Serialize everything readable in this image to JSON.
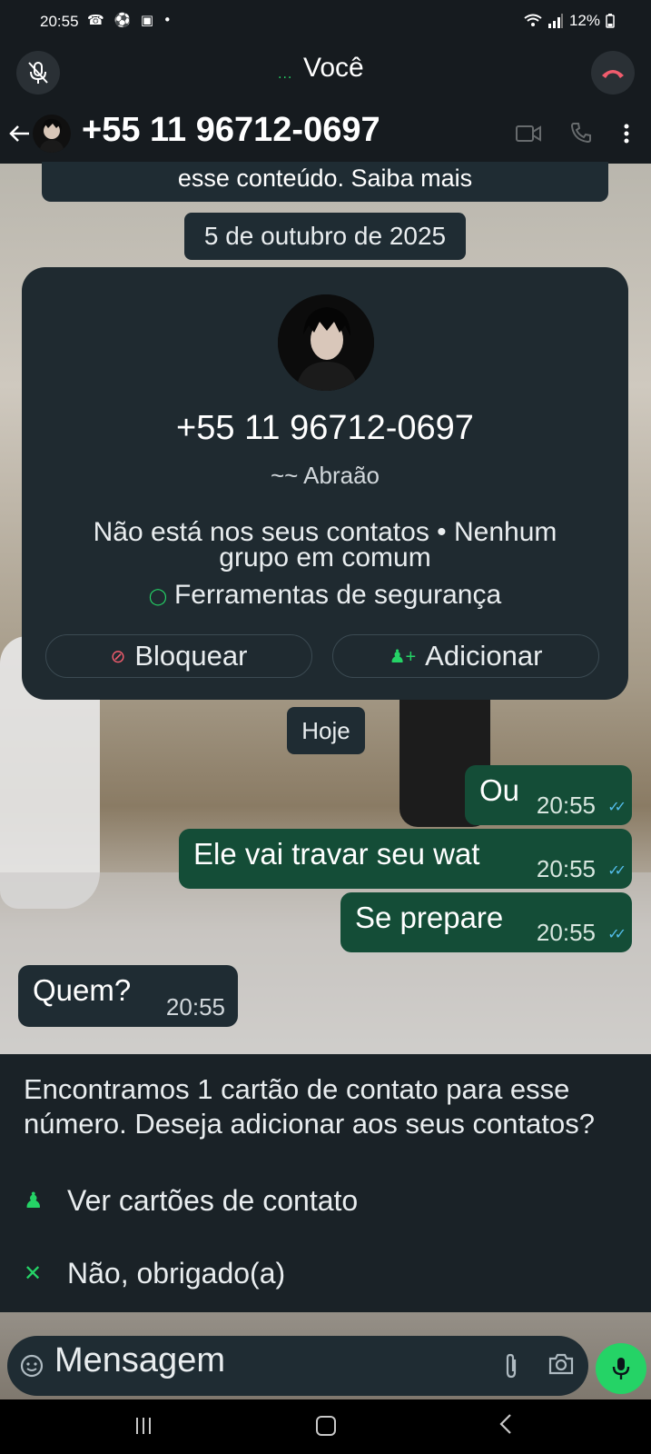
{
  "status_bar": {
    "time": "20:55",
    "left_icons": "☎ ⚽ ▣ •",
    "battery": "12%"
  },
  "call": {
    "title": "Você",
    "dots": "···"
  },
  "header": {
    "phone_number": "+55 11 96712-0697"
  },
  "encryption_notice": {
    "text": "esse conteúdo. Saiba mais"
  },
  "date_chips": [
    "5 de outubro de 2025",
    "Hoje"
  ],
  "profile_card": {
    "phone_number": "+55 11 96712-0697",
    "name": "~~ Abraão",
    "info": "Não está nos seus contatos • Nenhum grupo em comum",
    "safety_tools": "Ferramentas de segurança",
    "block_label": "Bloquear",
    "add_label": "Adicionar"
  },
  "messages": [
    {
      "direction": "out",
      "text": "Ou",
      "time": "20:55",
      "read": true
    },
    {
      "direction": "out",
      "text": "Ele vai travar seu wat",
      "time": "20:55",
      "read": true
    },
    {
      "direction": "out",
      "text": "Se prepare",
      "time": "20:55",
      "read": true
    },
    {
      "direction": "in",
      "text": "Quem?",
      "time": "20:55"
    }
  ],
  "contact_banner": {
    "text": "Encontramos 1 cartão de contato para esse número. Deseja adicionar aos seus contatos?",
    "view_cards": "Ver cartões de contato",
    "decline": "Não, obrigado(a)"
  },
  "composer": {
    "placeholder": "Mensagem"
  },
  "colors": {
    "accent_green": "#25d366",
    "outgoing_bubble": "#144d37",
    "incoming_bubble": "#1f2c33",
    "read_ticks": "#53bdeb",
    "block_red": "#f15c6d"
  },
  "icons": {
    "mute": "mic-off-icon",
    "end_call": "end-call-icon",
    "back": "arrow-left-icon",
    "video": "video-camera-icon",
    "voice": "phone-icon",
    "menu": "more-vertical-icon",
    "emoji": "sticker-icon",
    "attach": "paperclip-icon",
    "camera": "camera-icon",
    "mic": "mic-icon"
  }
}
